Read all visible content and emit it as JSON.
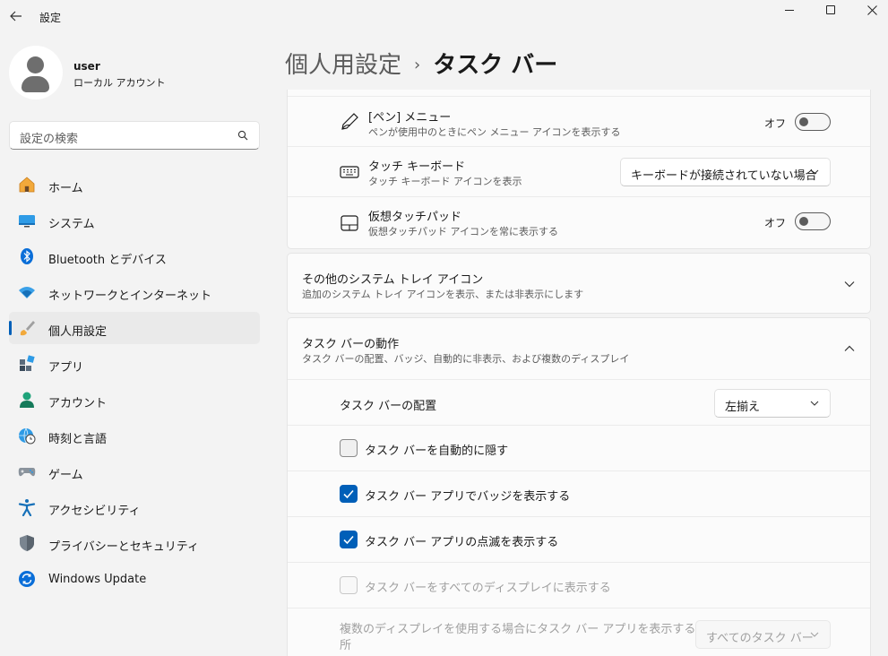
{
  "window": {
    "title": "設定"
  },
  "profile": {
    "name": "user",
    "account_type": "ローカル アカウント"
  },
  "search": {
    "placeholder": "設定の検索"
  },
  "nav": {
    "items": [
      {
        "label": "ホーム",
        "icon": "home-icon"
      },
      {
        "label": "システム",
        "icon": "system-icon"
      },
      {
        "label": "Bluetooth とデバイス",
        "icon": "bluetooth-icon"
      },
      {
        "label": "ネットワークとインターネット",
        "icon": "wifi-icon"
      },
      {
        "label": "個人用設定",
        "icon": "brush-icon",
        "active": true
      },
      {
        "label": "アプリ",
        "icon": "apps-icon"
      },
      {
        "label": "アカウント",
        "icon": "account-icon"
      },
      {
        "label": "時刻と言語",
        "icon": "clock-globe-icon"
      },
      {
        "label": "ゲーム",
        "icon": "gamepad-icon"
      },
      {
        "label": "アクセシビリティ",
        "icon": "accessibility-icon"
      },
      {
        "label": "プライバシーとセキュリティ",
        "icon": "shield-icon"
      },
      {
        "label": "Windows Update",
        "icon": "update-icon"
      }
    ]
  },
  "header": {
    "parent": "個人用設定",
    "separator": "›",
    "current": "タスク バー"
  },
  "tray_icons": {
    "pen": {
      "title": "[ペン] メニュー",
      "subtitle": "ペンが使用中のときにペン メニュー アイコンを表示する",
      "state_label": "オフ",
      "icon": "pen-icon"
    },
    "touch_keyboard": {
      "title": "タッチ キーボード",
      "subtitle": "タッチ キーボード アイコンを表示",
      "value": "キーボードが接続されていない場合",
      "icon": "keyboard-icon"
    },
    "touchpad": {
      "title": "仮想タッチパッド",
      "subtitle": "仮想タッチパッド アイコンを常に表示する",
      "state_label": "オフ",
      "icon": "touchpad-icon"
    }
  },
  "other_tray": {
    "title": "その他のシステム トレイ アイコン",
    "subtitle": "追加のシステム トレイ アイコンを表示、または非表示にします"
  },
  "behaviors": {
    "title": "タスク バーの動作",
    "subtitle": "タスク バーの配置、バッジ、自動的に非表示、および複数のディスプレイ",
    "alignment": {
      "label": "タスク バーの配置",
      "value": "左揃え"
    },
    "auto_hide": {
      "label": "タスク バーを自動的に隠す",
      "checked": false
    },
    "badges": {
      "label": "タスク バー アプリでバッジを表示する",
      "checked": true
    },
    "flashing": {
      "label": "タスク バー アプリの点滅を表示する",
      "checked": true
    },
    "all_displays": {
      "label": "タスク バーをすべてのディスプレイに表示する",
      "checked": false,
      "disabled": true
    },
    "multi_display": {
      "label_line1": "複数のディスプレイを使用する場合にタスク バー アプリを表示する場",
      "label_line2": "所",
      "value": "すべてのタスク バー",
      "disabled": true
    }
  },
  "colors": {
    "accent": "#005fb8",
    "background": "#f3f3f3",
    "card": "#fbfbfb"
  }
}
